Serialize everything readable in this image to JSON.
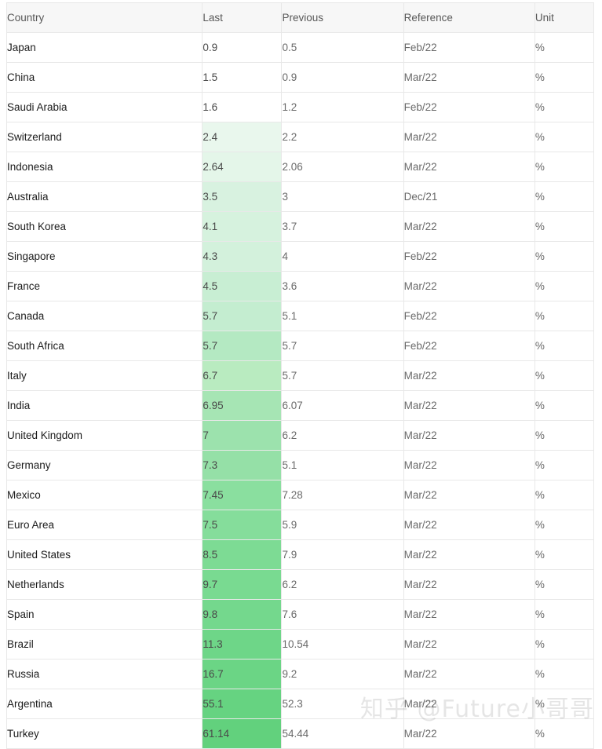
{
  "table": {
    "columns": [
      {
        "key": "country",
        "label": "Country"
      },
      {
        "key": "last",
        "label": "Last"
      },
      {
        "key": "previous",
        "label": "Previous"
      },
      {
        "key": "reference",
        "label": "Reference"
      },
      {
        "key": "unit",
        "label": "Unit"
      }
    ],
    "rows": [
      {
        "country": "Japan",
        "last": "0.9",
        "previous": "0.5",
        "reference": "Feb/22",
        "unit": "%",
        "heat": null
      },
      {
        "country": "China",
        "last": "1.5",
        "previous": "0.9",
        "reference": "Mar/22",
        "unit": "%",
        "heat": null
      },
      {
        "country": "Saudi Arabia",
        "last": "1.6",
        "previous": "1.2",
        "reference": "Feb/22",
        "unit": "%",
        "heat": null
      },
      {
        "country": "Switzerland",
        "last": "2.4",
        "previous": "2.2",
        "reference": "Mar/22",
        "unit": "%",
        "heat": "#e9f7ed"
      },
      {
        "country": "Indonesia",
        "last": "2.64",
        "previous": "2.06",
        "reference": "Mar/22",
        "unit": "%",
        "heat": "#e4f6e9"
      },
      {
        "country": "Australia",
        "last": "3.5",
        "previous": "3",
        "reference": "Dec/21",
        "unit": "%",
        "heat": "#d8f2e0"
      },
      {
        "country": "South Korea",
        "last": "4.1",
        "previous": "3.7",
        "reference": "Mar/22",
        "unit": "%",
        "heat": "#d6f2de"
      },
      {
        "country": "Singapore",
        "last": "4.3",
        "previous": "4",
        "reference": "Feb/22",
        "unit": "%",
        "heat": "#d3f1dc"
      },
      {
        "country": "France",
        "last": "4.5",
        "previous": "3.6",
        "reference": "Mar/22",
        "unit": "%",
        "heat": "#c8eed3"
      },
      {
        "country": "Canada",
        "last": "5.7",
        "previous": "5.1",
        "reference": "Feb/22",
        "unit": "%",
        "heat": "#c4edd0"
      },
      {
        "country": "South Africa",
        "last": "5.7",
        "previous": "5.7",
        "reference": "Feb/22",
        "unit": "%",
        "heat": "#b4e9c2"
      },
      {
        "country": "Italy",
        "last": "6.7",
        "previous": "5.7",
        "reference": "Mar/22",
        "unit": "%",
        "heat": "#b9ebc0"
      },
      {
        "country": "India",
        "last": "6.95",
        "previous": "6.07",
        "reference": "Mar/22",
        "unit": "%",
        "heat": "#a6e5b4"
      },
      {
        "country": "United Kingdom",
        "last": "7",
        "previous": "6.2",
        "reference": "Mar/22",
        "unit": "%",
        "heat": "#9ce2ad"
      },
      {
        "country": "Germany",
        "last": "7.3",
        "previous": "5.1",
        "reference": "Mar/22",
        "unit": "%",
        "heat": "#95e0a7"
      },
      {
        "country": "Mexico",
        "last": "7.45",
        "previous": "7.28",
        "reference": "Mar/22",
        "unit": "%",
        "heat": "#8adf9f"
      },
      {
        "country": "Euro Area",
        "last": "7.5",
        "previous": "5.9",
        "reference": "Mar/22",
        "unit": "%",
        "heat": "#85dd9b"
      },
      {
        "country": "United States",
        "last": "8.5",
        "previous": "7.9",
        "reference": "Mar/22",
        "unit": "%",
        "heat": "#7ddb94"
      },
      {
        "country": "Netherlands",
        "last": "9.7",
        "previous": "6.2",
        "reference": "Mar/22",
        "unit": "%",
        "heat": "#79da91"
      },
      {
        "country": "Spain",
        "last": "9.8",
        "previous": "7.6",
        "reference": "Mar/22",
        "unit": "%",
        "heat": "#74d88d"
      },
      {
        "country": "Brazil",
        "last": "11.3",
        "previous": "10.54",
        "reference": "Mar/22",
        "unit": "%",
        "heat": "#6ed688"
      },
      {
        "country": "Russia",
        "last": "16.7",
        "previous": "9.2",
        "reference": "Mar/22",
        "unit": "%",
        "heat": "#6bd585"
      },
      {
        "country": "Argentina",
        "last": "55.1",
        "previous": "52.3",
        "reference": "Mar/22",
        "unit": "%",
        "heat": "#66d381"
      },
      {
        "country": "Turkey",
        "last": "61.14",
        "previous": "54.44",
        "reference": "Mar/22",
        "unit": "%",
        "heat": "#62d17d"
      }
    ]
  },
  "watermark": {
    "text": "知乎 @Future小哥哥"
  }
}
